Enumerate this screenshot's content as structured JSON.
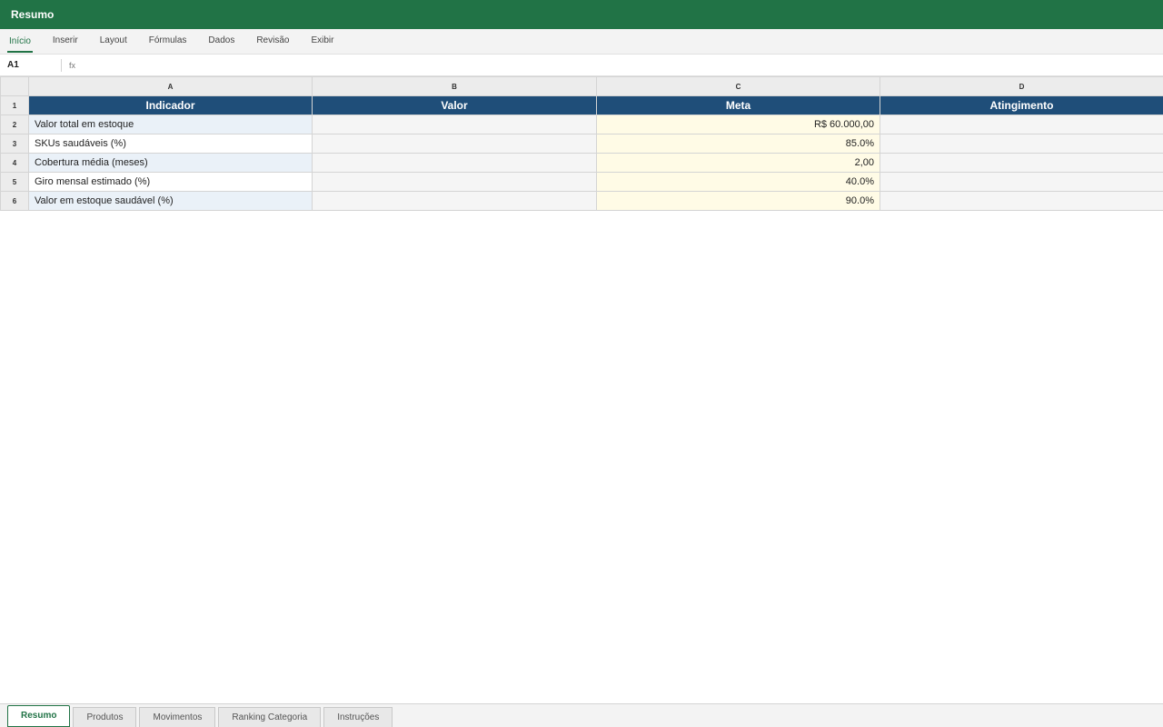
{
  "window": {
    "title": "Resumo"
  },
  "ribbon": {
    "tabs": [
      {
        "label": "Início",
        "active": true
      },
      {
        "label": "Inserir"
      },
      {
        "label": "Layout"
      },
      {
        "label": "Fórmulas"
      },
      {
        "label": "Dados"
      },
      {
        "label": "Revisão"
      },
      {
        "label": "Exibir"
      }
    ]
  },
  "formula_bar": {
    "cell_ref": "A1",
    "fx_label": "fx",
    "value": ""
  },
  "sheet": {
    "columns": [
      "A",
      "B",
      "C",
      "D"
    ],
    "header": {
      "row": "1",
      "cells": [
        "Indicador",
        "Valor",
        "Meta",
        "Atingimento"
      ]
    },
    "rows": [
      {
        "row": "2",
        "indicador": "Valor total em estoque",
        "valor": "",
        "meta": "R$ 60.000,00",
        "atingimento": ""
      },
      {
        "row": "3",
        "indicador": "SKUs saudáveis (%)",
        "valor": "",
        "meta": "85.0%",
        "atingimento": ""
      },
      {
        "row": "4",
        "indicador": "Cobertura média (meses)",
        "valor": "",
        "meta": "2,00",
        "atingimento": ""
      },
      {
        "row": "5",
        "indicador": "Giro mensal estimado (%)",
        "valor": "",
        "meta": "40.0%",
        "atingimento": ""
      },
      {
        "row": "6",
        "indicador": "Valor em estoque saudável (%)",
        "valor": "",
        "meta": "90.0%",
        "atingimento": ""
      }
    ]
  },
  "sheet_tabs": [
    {
      "label": "Resumo",
      "active": true
    },
    {
      "label": "Produtos"
    },
    {
      "label": "Movimentos"
    },
    {
      "label": "Ranking Categoria"
    },
    {
      "label": "Instruções"
    }
  ],
  "colors": {
    "titlebar": "#217346",
    "header_fill": "#1f4e79",
    "meta_fill": "#fffbe6",
    "indicador_alt_fill": "#eaf1f8"
  }
}
